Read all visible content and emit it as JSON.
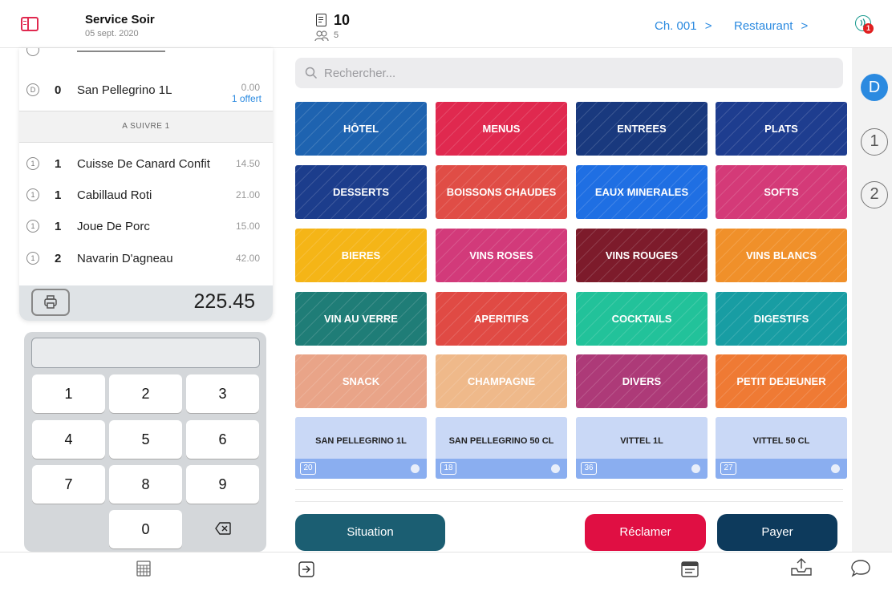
{
  "header": {
    "service_title": "Service Soir",
    "service_date": "05 sept. 2020",
    "ticket_number": "10",
    "guests": "5",
    "room_label": "Ch. 001",
    "room_chevron": ">",
    "location_label": "Restaurant",
    "location_chevron": ">",
    "notification_count": "1"
  },
  "order": {
    "rows": [
      {
        "status": "D",
        "qty": "0",
        "name": "San Pellegrino 1L",
        "price": "0.00",
        "note": "1 offert"
      },
      {
        "status": "1",
        "qty": "1",
        "name": "Cuisse De Canard Confit",
        "price": "14.50"
      },
      {
        "status": "1",
        "qty": "1",
        "name": "Cabillaud Roti",
        "price": "21.00"
      },
      {
        "status": "1",
        "qty": "1",
        "name": "Joue De Porc",
        "price": "15.00"
      },
      {
        "status": "1",
        "qty": "2",
        "name": "Navarin D'agneau",
        "price": "42.00"
      }
    ],
    "section_header": "A SUIVRE 1",
    "total": "225.45"
  },
  "keypad": {
    "keys": [
      "1",
      "2",
      "3",
      "4",
      "5",
      "6",
      "7",
      "8",
      "9",
      "0"
    ],
    "backspace_icon": "backspace-icon"
  },
  "search": {
    "placeholder": "Rechercher..."
  },
  "categories": [
    {
      "label": "HÔTEL",
      "color": "#1e63b0"
    },
    {
      "label": "MENUS",
      "color": "#e0294f"
    },
    {
      "label": "ENTREES",
      "color": "#19397e"
    },
    {
      "label": "PLATS",
      "color": "#1e3d8f"
    },
    {
      "label": "DESSERTS",
      "color": "#1c3d8c"
    },
    {
      "label": "BOISSONS CHAUDES",
      "color": "#e04d46"
    },
    {
      "label": "EAUX MINERALES",
      "color": "#1f6fe3"
    },
    {
      "label": "SOFTS",
      "color": "#d43a78"
    },
    {
      "label": "BIERES",
      "color": "#f5b517"
    },
    {
      "label": "VINS ROSES",
      "color": "#d23a7a"
    },
    {
      "label": "VINS ROUGES",
      "color": "#7d1b2b"
    },
    {
      "label": "VINS BLANCS",
      "color": "#f0902a"
    },
    {
      "label": "VIN AU VERRE",
      "color": "#1f7d77"
    },
    {
      "label": "APERITIFS",
      "color": "#e04a44"
    },
    {
      "label": "COCKTAILS",
      "color": "#22c29a"
    },
    {
      "label": "DIGESTIFS",
      "color": "#189da3"
    },
    {
      "label": "SNACK",
      "color": "#e9a488"
    },
    {
      "label": "CHAMPAGNE",
      "color": "#efb98a"
    },
    {
      "label": "DIVERS",
      "color": "#ad3a78"
    },
    {
      "label": "PETIT DEJEUNER",
      "color": "#ef7a34"
    }
  ],
  "products": [
    {
      "label": "SAN PELLEGRINO 1L",
      "count": "20"
    },
    {
      "label": "SAN PELLEGRINO 50 CL",
      "count": "18"
    },
    {
      "label": "VITTEL 1L",
      "count": "36"
    },
    {
      "label": "VITTEL 50 CL",
      "count": "27"
    }
  ],
  "actions": {
    "situation": "Situation",
    "reclamer": "Réclamer",
    "payer": "Payer",
    "colors": {
      "situation": "#1b5e72",
      "reclamer": "#e00f43",
      "payer": "#0d3a5c"
    }
  },
  "seats": {
    "dine": "D",
    "seat1": "1",
    "seat2": "2"
  }
}
